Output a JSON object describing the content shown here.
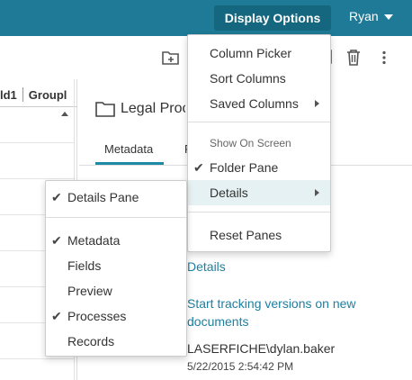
{
  "topbar": {
    "display_options_label": "Display Options",
    "user_label": "Ryan"
  },
  "toolbar": {
    "icons": [
      "new-folder-icon",
      "trash-icon",
      "more-vert-icon"
    ]
  },
  "browser": {
    "columns": [
      "ld1",
      "Groupl"
    ]
  },
  "details_panel": {
    "title": "Legal Proc",
    "tabs": [
      "Metadata",
      "P"
    ],
    "details_link": "Details",
    "versions_link": "Start tracking versions on new documents",
    "owner": "LASERFICHE\\dylan.baker",
    "timestamp": "5/22/2015 2:54:42 PM"
  },
  "display_menu": {
    "column_picker": "Column Picker",
    "sort_columns": "Sort Columns",
    "saved_columns": "Saved Columns",
    "section_header": "Show On Screen",
    "folder_pane": "Folder Pane",
    "details": "Details",
    "reset_panes": "Reset Panes"
  },
  "details_submenu": {
    "details_pane": "Details Pane",
    "metadata": "Metadata",
    "fields": "Fields",
    "preview": "Preview",
    "processes": "Processes",
    "records": "Records"
  }
}
